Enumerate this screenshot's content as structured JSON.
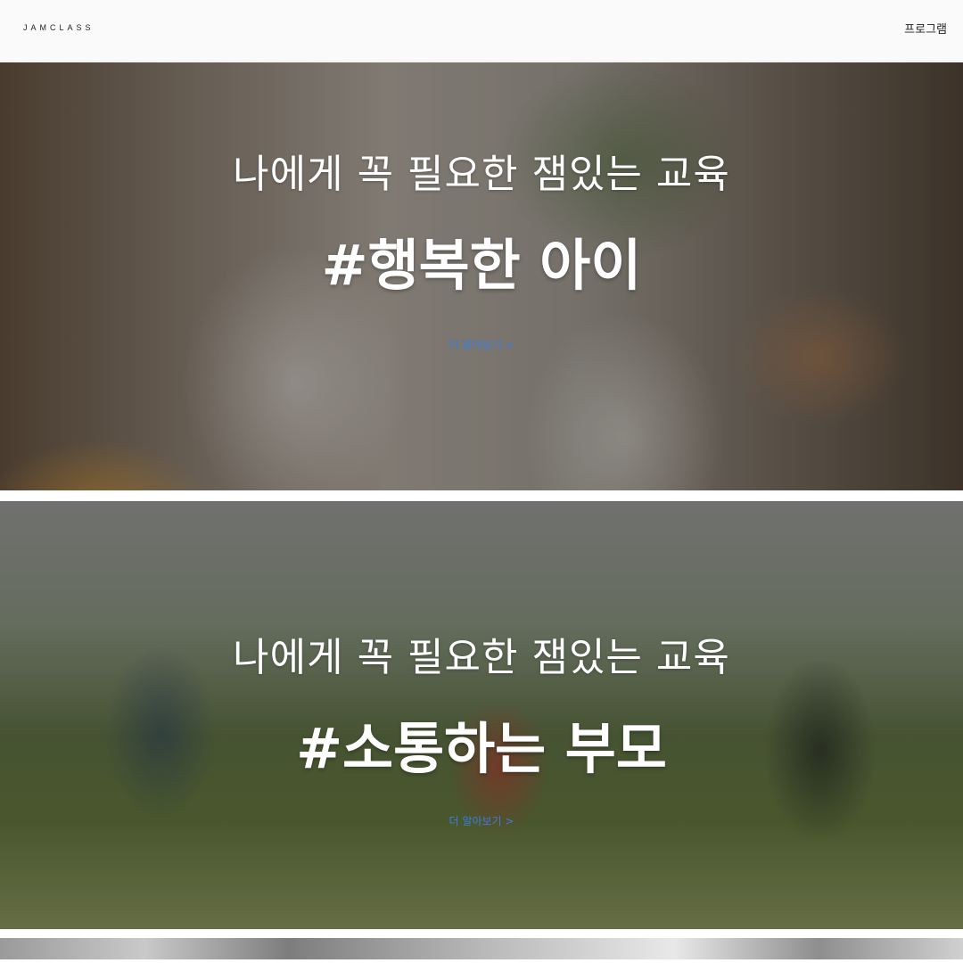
{
  "header": {
    "logo": "JAMCLASS",
    "nav_program": "프로그램"
  },
  "sections": [
    {
      "subtitle": "나에게 꼭 필요한 잼있는 교육",
      "title": "#행복한 아이",
      "more_link": "더 알아보기 >"
    },
    {
      "subtitle": "나에게 꼭 필요한 잼있는 교육",
      "title": "#소통하는 부모",
      "more_link": "더 알아보기 >"
    }
  ],
  "colors": {
    "link": "#3a7de0",
    "header_bg": "#fafafa",
    "hero_text": "#ffffff"
  }
}
